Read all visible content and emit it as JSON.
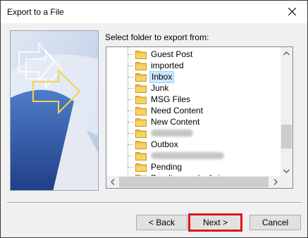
{
  "window": {
    "title": "Export to a File"
  },
  "prompt": "Select folder to export from:",
  "folders": [
    {
      "label": "Guest Post"
    },
    {
      "label": "imported"
    },
    {
      "label": "Inbox",
      "selected": true
    },
    {
      "label": "Junk"
    },
    {
      "label": "MSG Files"
    },
    {
      "label": "Need Content"
    },
    {
      "label": "New Content"
    },
    {
      "label": "",
      "redacted": true
    },
    {
      "label": "Outbox"
    },
    {
      "label": "",
      "redacted": true
    },
    {
      "label": "Pending"
    },
    {
      "label": "Pending work of sir"
    }
  ],
  "buttons": {
    "back": "< Back",
    "next": "Next >",
    "cancel": "Cancel"
  },
  "colors": {
    "highlight": "#e0161e",
    "selection": "#cce8ff",
    "folder": "#f5c542",
    "wizard_blue": "#2f5aa8"
  }
}
